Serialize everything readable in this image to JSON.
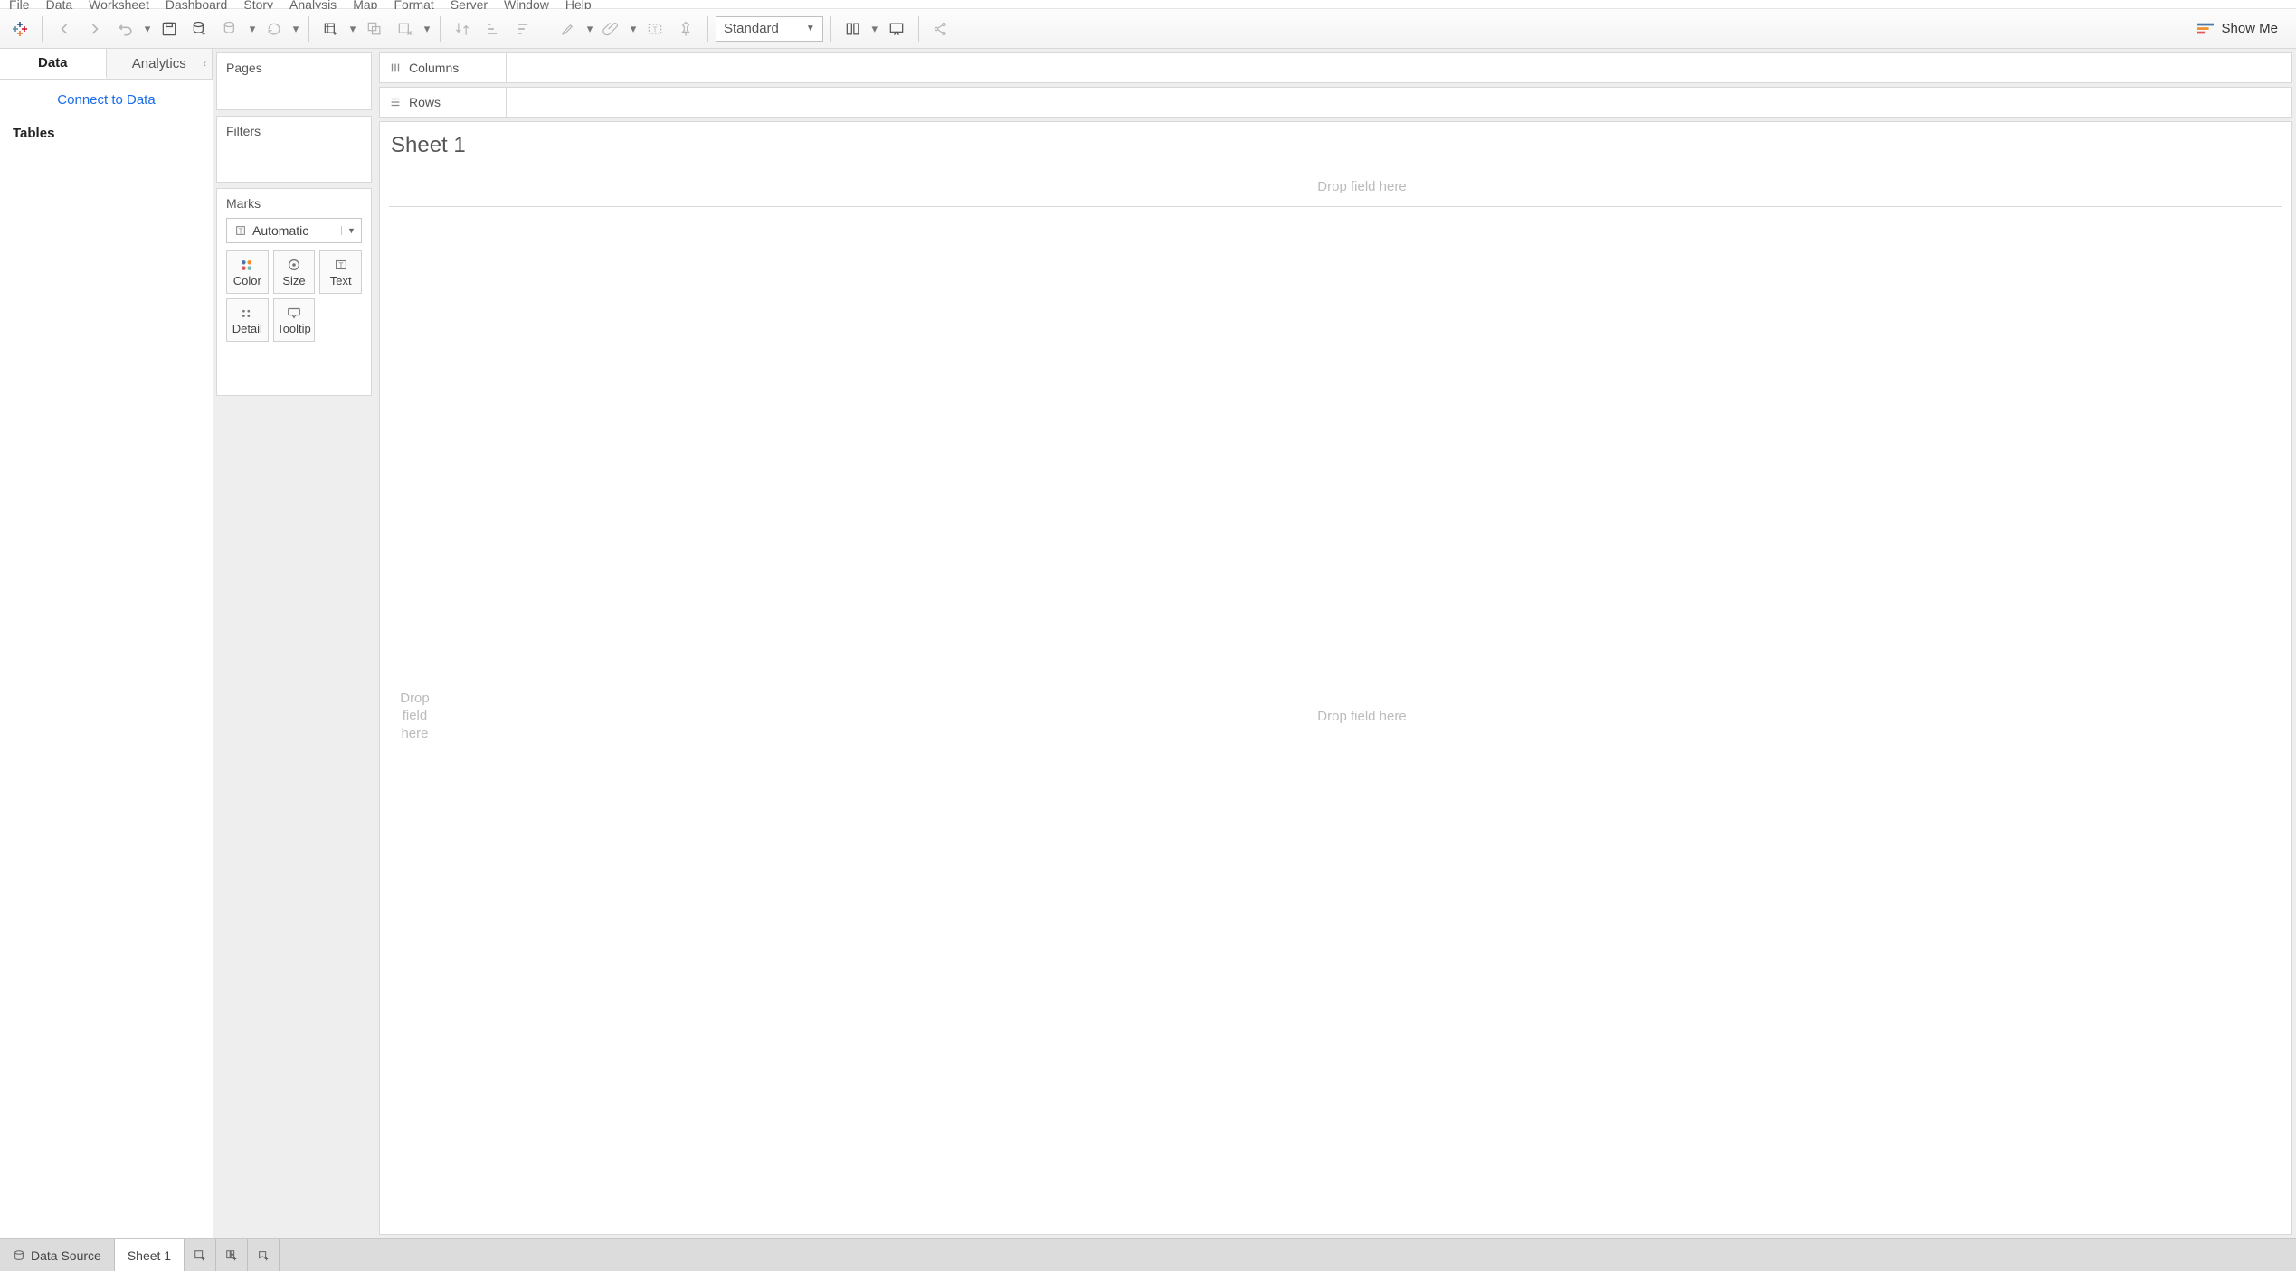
{
  "menu": {
    "file": "File",
    "data": "Data",
    "worksheet": "Worksheet",
    "dashboard": "Dashboard",
    "story": "Story",
    "analysis": "Analysis",
    "map": "Map",
    "format": "Format",
    "server": "Server",
    "window": "Window",
    "help": "Help"
  },
  "toolbar": {
    "fit_mode": "Standard",
    "showme": "Show Me"
  },
  "left": {
    "tab_data": "Data",
    "tab_analytics": "Analytics",
    "connect": "Connect to Data",
    "tables": "Tables"
  },
  "cards": {
    "pages": "Pages",
    "filters": "Filters",
    "marks": "Marks",
    "mark_type": "Automatic",
    "color": "Color",
    "size": "Size",
    "text": "Text",
    "detail": "Detail",
    "tooltip": "Tooltip"
  },
  "shelves": {
    "columns": "Columns",
    "rows": "Rows"
  },
  "sheet": {
    "title": "Sheet 1",
    "drop_top": "Drop field here",
    "drop_left": "Drop\nfield\nhere",
    "drop_main": "Drop field here"
  },
  "bottom": {
    "data_source": "Data Source",
    "sheet1": "Sheet 1"
  }
}
